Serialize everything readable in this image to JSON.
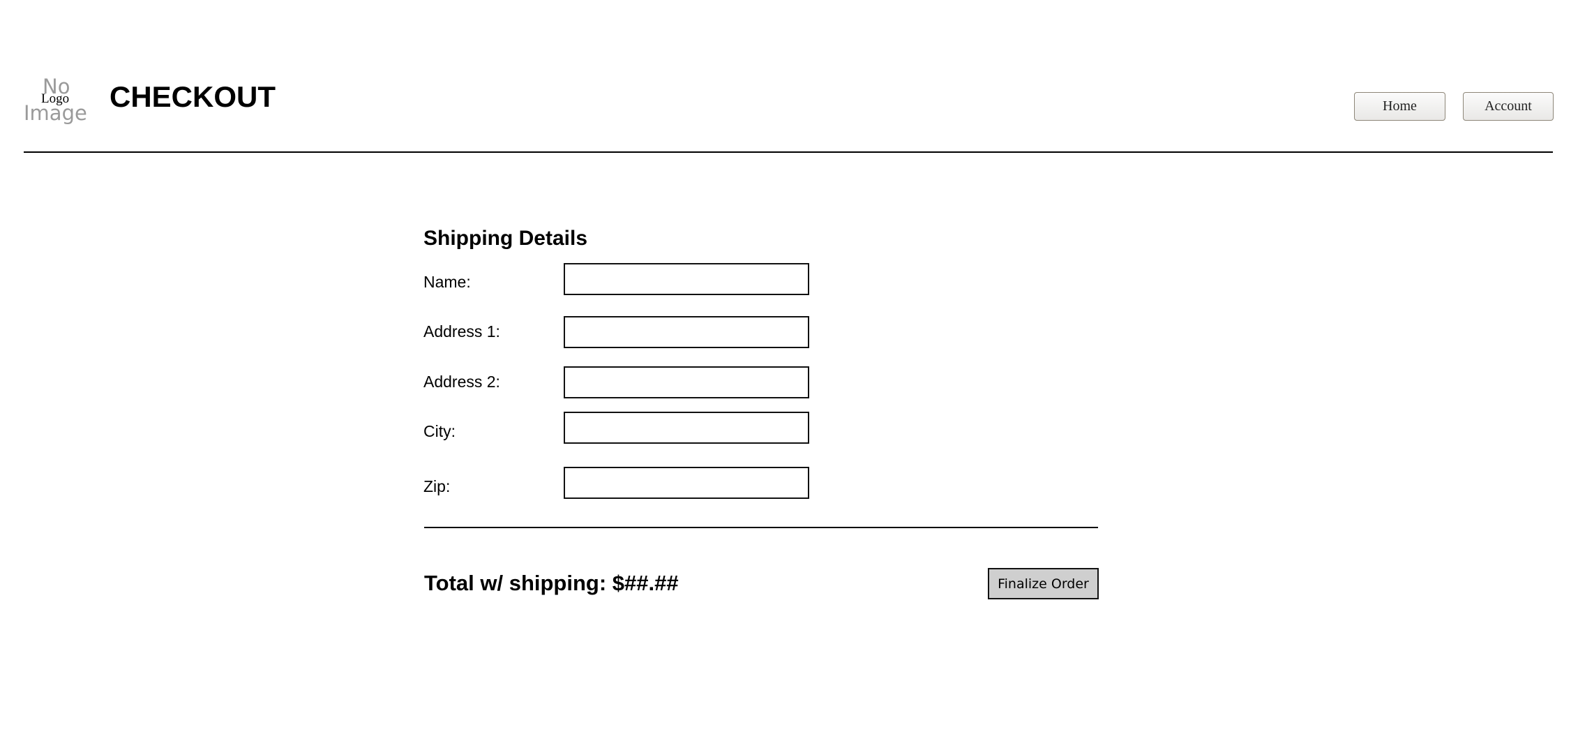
{
  "header": {
    "logo": {
      "line1": "No",
      "line2": "Logo",
      "line3": "Image"
    },
    "title": "CHECKOUT",
    "nav": [
      {
        "label": "Home"
      },
      {
        "label": "Account"
      }
    ]
  },
  "form": {
    "section_title": "Shipping Details",
    "fields": [
      {
        "label": "Name:",
        "value": ""
      },
      {
        "label": "Address 1:",
        "value": ""
      },
      {
        "label": "Address 2:",
        "value": ""
      },
      {
        "label": "City:",
        "value": ""
      },
      {
        "label": "Zip:",
        "value": ""
      }
    ]
  },
  "summary": {
    "total_text": "Total w/ shipping: $##.##",
    "finalize_label": "Finalize Order"
  },
  "colors": {
    "button_fill": "#cfcfcf",
    "nav_border": "#8d8678",
    "logo_gray": "#9a9a9a"
  }
}
